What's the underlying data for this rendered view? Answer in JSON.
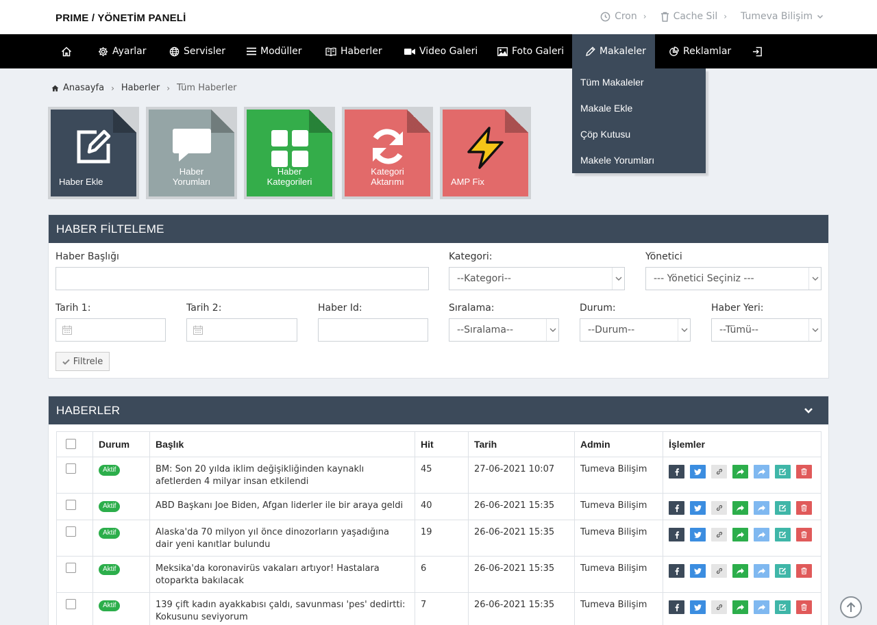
{
  "brand": "PRIME / YÖNETİM PANELİ",
  "topbar": {
    "cron": "Cron",
    "cache": "Cache Sil",
    "user": "Tumeva Bilişim"
  },
  "nav": {
    "items": [
      {
        "label": "Ayarlar"
      },
      {
        "label": "Servisler"
      },
      {
        "label": "Modüller"
      },
      {
        "label": "Haberler"
      },
      {
        "label": "Video Galeri"
      },
      {
        "label": "Foto Galeri"
      },
      {
        "label": "Makaleler"
      },
      {
        "label": "Reklamlar"
      }
    ],
    "active": "Makaleler",
    "dropdown": [
      "Tüm Makaleler",
      "Makale Ekle",
      "Çöp Kutusu",
      "Makele Yorumları"
    ]
  },
  "breadcrumb": [
    "Anasayfa",
    "Haberler",
    "Tüm Haberler"
  ],
  "tiles": [
    {
      "line1": "Haber Ekle",
      "line2": "",
      "color": "#3c4a5a",
      "icon": "edit-icon"
    },
    {
      "line1": "Haber",
      "line2": "Yorumları",
      "color": "#95a5a6",
      "icon": "comment-icon"
    },
    {
      "line1": "Haber",
      "line2": "Kategorileri",
      "color": "#34ad4a",
      "icon": "grid-icon"
    },
    {
      "line1": "Kategori",
      "line2": "Aktarımı",
      "color": "#e26a6a",
      "icon": "refresh-icon"
    },
    {
      "line1": "AMP Fix",
      "line2": "",
      "color": "#e26a6a",
      "icon": "lightning-icon"
    }
  ],
  "filter": {
    "title": "HABER FİLTELEME",
    "labels": {
      "title": "Haber Başlığı",
      "category": "Kategori:",
      "manager": "Yönetici",
      "date1": "Tarih 1:",
      "date2": "Tarih 2:",
      "id": "Haber Id:",
      "sort": "Sıralama:",
      "status": "Durum:",
      "place": "Haber Yeri:"
    },
    "selects": {
      "category": "--Kategori--",
      "manager": "--- Yönetici Seçiniz ---",
      "sort": "--Sıralama--",
      "status": "--Durum--",
      "place": "--Tümü--"
    },
    "button": "Filtrele"
  },
  "news": {
    "title": "HABERLER",
    "columns": [
      "Durum",
      "Başlık",
      "Hit",
      "Tarih",
      "Admin",
      "İşlemler"
    ],
    "rows": [
      {
        "status": "Aktif",
        "title": "BM: Son 20 yılda iklim değişikliğinden kaynaklı afetlerden 4 milyar insan etkilendi",
        "hit": "45",
        "date": "27-06-2021 10:07",
        "admin": "Tumeva Bilişim"
      },
      {
        "status": "Aktif",
        "title": "ABD Başkanı Joe Biden, Afgan liderler ile bir araya geldi",
        "hit": "40",
        "date": "26-06-2021 15:35",
        "admin": "Tumeva Bilişim"
      },
      {
        "status": "Aktif",
        "title": "Alaska'da 70 milyon yıl önce dinozorların yaşadığına dair yeni kanıtlar bulundu",
        "hit": "19",
        "date": "26-06-2021 15:35",
        "admin": "Tumeva Bilişim"
      },
      {
        "status": "Aktif",
        "title": "Meksika'da koronavirüs vakaları artıyor! Hastalara otoparkta bakılacak",
        "hit": "6",
        "date": "26-06-2021 15:35",
        "admin": "Tumeva Bilişim"
      },
      {
        "status": "Aktif",
        "title": "139 çift kadın ayakkabısı çaldı, savunması 'pes' dedirtti: Kokusunu seviyorum",
        "hit": "7",
        "date": "26-06-2021 15:35",
        "admin": "Tumeva Bilişim"
      }
    ],
    "actions": [
      {
        "icon": "facebook-icon",
        "color": "#3c4a5a"
      },
      {
        "icon": "twitter-icon",
        "color": "#3b8de0"
      },
      {
        "icon": "link-icon",
        "color": "#e5e5e5"
      },
      {
        "icon": "share-icon",
        "color": "#2cae4b"
      },
      {
        "icon": "share-light-icon",
        "color": "#7fb8f0"
      },
      {
        "icon": "edit-icon",
        "color": "#3fb6a8"
      },
      {
        "icon": "trash-icon",
        "color": "#e05a5a"
      }
    ]
  },
  "colors": {
    "panel_header": "#3c4a5a",
    "navbar": "#000000",
    "background": "#edf0f4",
    "status_green": "#2cae4b"
  }
}
